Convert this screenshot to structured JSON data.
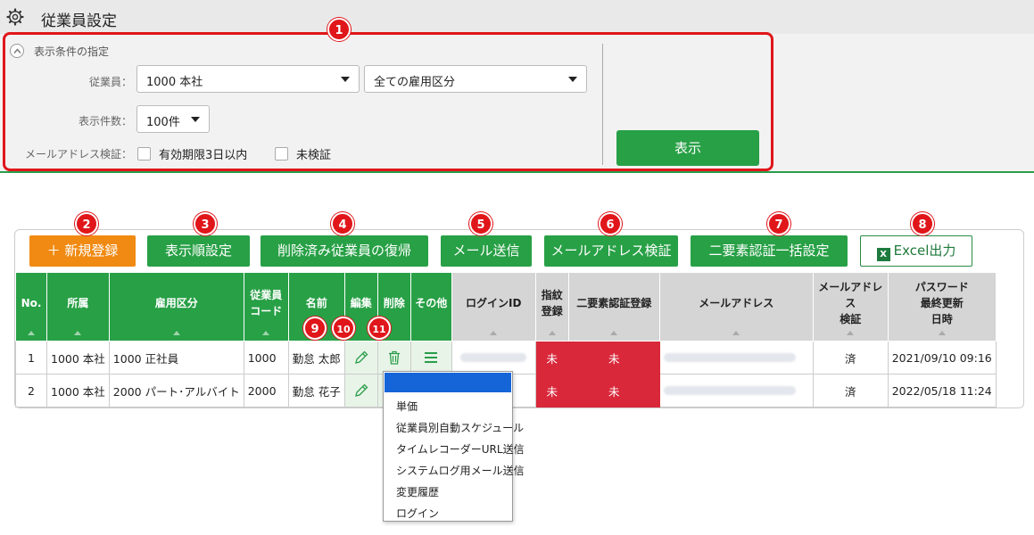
{
  "header": {
    "title": "従業員設定",
    "icon": "gear-icon"
  },
  "filter": {
    "heading": "表示条件の指定",
    "employee_label": "従業員：",
    "employee_value": "1000 本社",
    "employment_value": "全ての雇用区分",
    "count_label": "表示件数：",
    "count_value": "100件",
    "mail_label": "メールアドレス検証：",
    "check_valid_label": "有効期限3日以内",
    "check_unverified_label": "未検証",
    "show_button": "表示"
  },
  "toolbar": {
    "new": "＋ 新規登録",
    "order": "表示順設定",
    "restore": "削除済み従業員の復帰",
    "send_mail": "メール送信",
    "verify_mail": "メールアドレス検証",
    "twofactor": "二要素認証一括設定",
    "excel": "Excel出力"
  },
  "table": {
    "headers": {
      "no": "No.",
      "office": "所属",
      "employment": "雇用区分",
      "code": "従業員\nコード",
      "name": "名前",
      "edit": "編集",
      "delete": "削除",
      "other": "その他",
      "login_id": "ログインID",
      "fingerprint": "指紋\n登録",
      "twofactor": "二要素認証登録",
      "email": "メールアドレス",
      "email_verified": "メールアドレス\n検証",
      "password_updated": "パスワード\n最終更新\n日時"
    },
    "rows": [
      {
        "no": "1",
        "office": "1000 本社",
        "employment": "1000 正社員",
        "code": "1000",
        "name": "勤怠 太郎",
        "fingerprint": "未",
        "twofactor": "未",
        "email_verified": "済",
        "password_updated": "2021/09/10 09:16"
      },
      {
        "no": "2",
        "office": "1000 本社",
        "employment": "2000 パート･アルバイト",
        "code": "2000",
        "name": "勤怠 花子",
        "fingerprint": "未",
        "twofactor": "未",
        "email_verified": "済",
        "password_updated": "2022/05/18 11:24"
      }
    ]
  },
  "other_menu": {
    "items": [
      "単価",
      "従業員別自動スケジュール",
      "タイムレコーダーURL送信",
      "システムログ用メール送信",
      "変更履歴",
      "ログイン"
    ]
  },
  "callouts": [
    "1",
    "2",
    "3",
    "4",
    "5",
    "6",
    "7",
    "8",
    "9",
    "10",
    "11"
  ],
  "colors": {
    "green": "#28a046",
    "orange": "#f08a12",
    "red": "#d9283a",
    "callout": "#e0161a",
    "highlight": "#1565d8"
  }
}
